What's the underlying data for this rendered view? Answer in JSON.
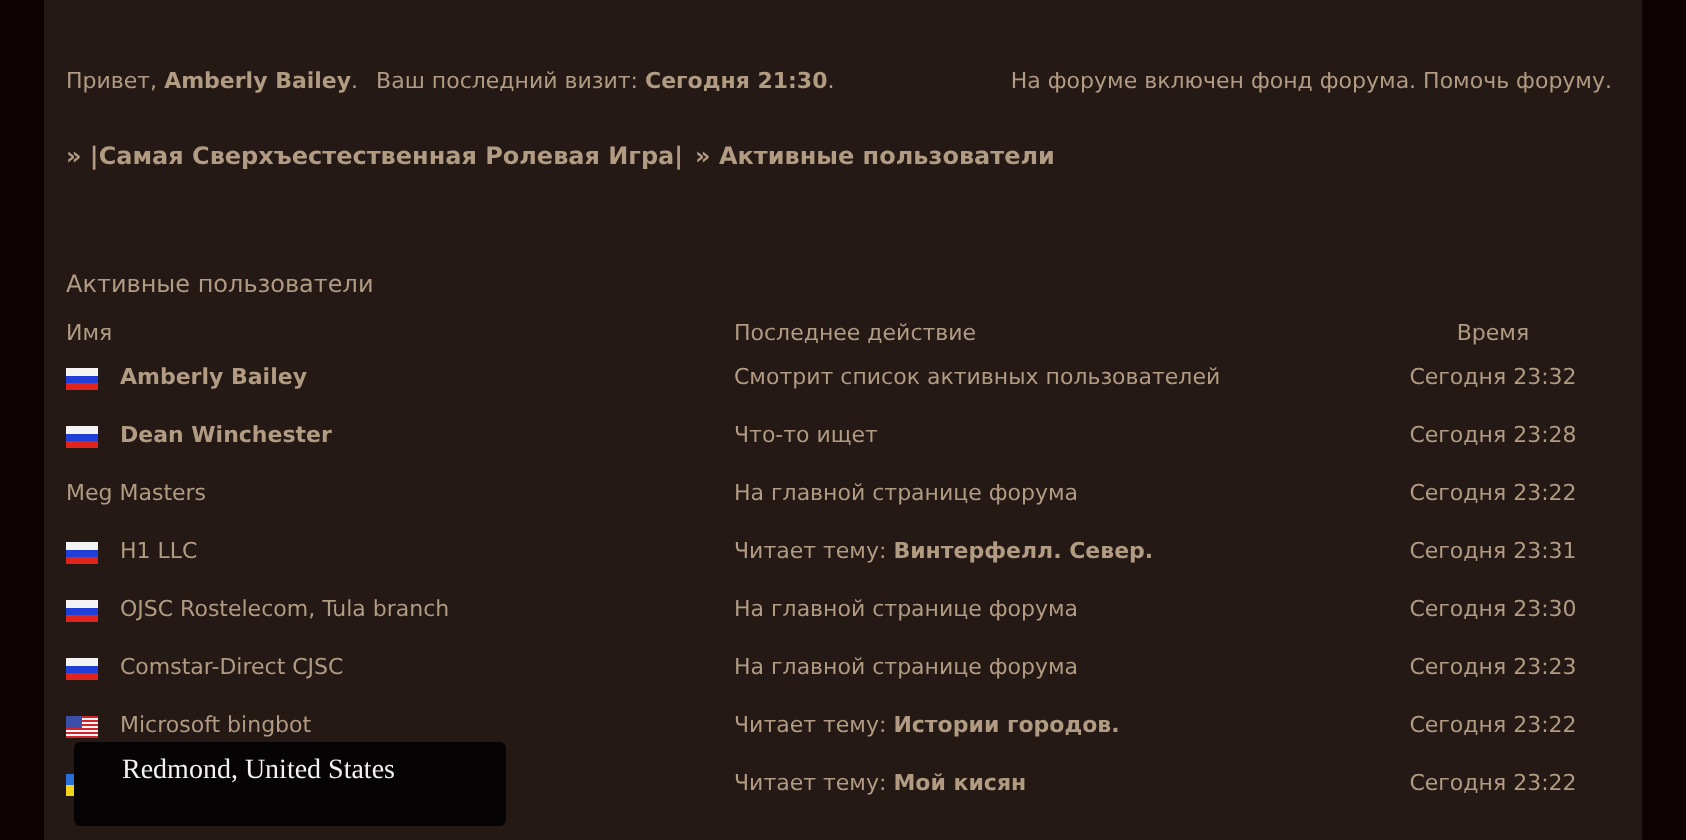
{
  "welcome": {
    "greeting": "Привет, **Amberly Bailey**.",
    "last_visit": "Ваш последний визит: **Сегодня 21:30**.",
    "fund_notice": "На форуме включен фонд форума. Помочь форуму."
  },
  "breadcrumb": [
    "» |Самая Сверхъестественная Ролевая Игра|",
    "» Активные пользователи"
  ],
  "section_title": "Активные пользователи",
  "table": {
    "columns": [
      "Имя",
      "Последнее действие",
      "Время"
    ],
    "rows": [
      {
        "kind": "ru",
        "name": "Amberly Bailey",
        "bold": true,
        "action": "Смотрит список активных пользователей",
        "time": "Сегодня 23:32"
      },
      {
        "kind": "ru",
        "name": "Dean Winchester",
        "bold": true,
        "action": "Что-то ищет",
        "time": "Сегодня 23:28"
      },
      {
        "kind": "none",
        "name": "Meg Masters",
        "bold": false,
        "action": "На главной странице форума",
        "time": "Сегодня 23:22"
      },
      {
        "kind": "ru",
        "name": "H1 LLC",
        "bold": false,
        "action": "Читает тему: **Винтерфелл. Север.**",
        "time": "Сегодня 23:31"
      },
      {
        "kind": "ru",
        "name": "OJSC Rostelecom, Tula branch",
        "bold": false,
        "action": "На главной странице форума",
        "time": "Сегодня 23:30"
      },
      {
        "kind": "ru",
        "name": "Comstar-Direct CJSC",
        "bold": false,
        "action": "На главной странице форума",
        "time": "Сегодня 23:23"
      },
      {
        "kind": "us",
        "name": "Microsoft bingbot",
        "bold": false,
        "action": "Читает тему: **Истории городов.**",
        "time": "Сегодня 23:22"
      },
      {
        "kind": "ua",
        "action": "Читает тему: **Мой кисян**",
        "time": "Сегодня 23:22"
      }
    ]
  },
  "tooltip": {
    "text": "Redmond, United States"
  }
}
